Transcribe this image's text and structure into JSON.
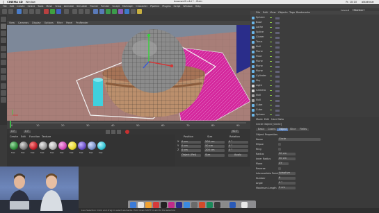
{
  "mac_menu": {
    "app_name": "CINEMA 4D",
    "items": [
      "Window"
    ],
    "clock": "Fr. 10:10",
    "user": "aldakhnar"
  },
  "c4d_menu": [
    "File",
    "Edit",
    "Create",
    "Select",
    "Tools",
    "Mesh",
    "Snap",
    "Animate",
    "Simulate",
    "Tracker",
    "Render",
    "Sculpt",
    "MoGraph",
    "Character",
    "Pipeline",
    "Plugins",
    "Script",
    "Window",
    "Help"
  ],
  "window_title": "bowowel2.c4d * - Main",
  "layout": {
    "label": "Layout",
    "value": "Startup"
  },
  "viewport_menu": [
    "View",
    "Cameras",
    "Display",
    "Options",
    "Filter",
    "Panel",
    "ProRender"
  ],
  "object_manager": {
    "menu": [
      "File",
      "Edit",
      "View",
      "Objects",
      "Tags",
      "Bookmarks"
    ],
    "rows": [
      {
        "name": "Sphere",
        "color": "#6bb6e8"
      },
      {
        "name": "Bowl",
        "color": "#6bb6e8"
      },
      {
        "name": "Lathe",
        "color": "#6bb6e8"
      },
      {
        "name": "Spline",
        "color": "#6bb6e8"
      },
      {
        "name": "Cloner",
        "color": "#6bb6e8"
      },
      {
        "name": "Torus",
        "color": "#6bb6e8"
      },
      {
        "name": "Null",
        "color": "#aaaaaa"
      },
      {
        "name": "Plane",
        "color": "#6bb6e8"
      },
      {
        "name": "Floor",
        "color": "#6bb6e8"
      },
      {
        "name": "Plane",
        "color": "#6bb6e8"
      },
      {
        "name": "Plane",
        "color": "#6bb6e8"
      },
      {
        "name": "Plane",
        "color": "#6bb6e8"
      },
      {
        "name": "Cylinder",
        "color": "#6bb6e8"
      },
      {
        "name": "Sky",
        "color": "#6bb6e8"
      },
      {
        "name": "Light",
        "color": "#d8d8d8"
      },
      {
        "name": "Camera",
        "color": "#d8d8d8"
      },
      {
        "name": "Null",
        "color": "#aaaaaa"
      },
      {
        "name": "Null",
        "color": "#aaaaaa"
      },
      {
        "name": "Cube",
        "color": "#6bb6e8"
      },
      {
        "name": "Cube",
        "color": "#6bb6e8"
      },
      {
        "name": "Sphere",
        "color": "#6bb6e8"
      }
    ]
  },
  "attribute_manager": {
    "menu": [
      "Mode",
      "Edit",
      "User Data"
    ],
    "title": "Circle Object [Circle]",
    "tabs": [
      "Basic",
      "Coord.",
      "Object",
      "Slice",
      "Fields"
    ],
    "section": "Object Properties",
    "props": [
      {
        "label": "Name",
        "value": "Circle"
      },
      {
        "label": "Ellipse",
        "value": ""
      },
      {
        "label": "Ring",
        "value": ""
      },
      {
        "label": "Radius",
        "value": "50 cm"
      },
      {
        "label": "Inner Radius",
        "value": "50 cm"
      },
      {
        "label": "Plane",
        "value": "XY"
      },
      {
        "label": "Reverse",
        "value": ""
      },
      {
        "label": "Intermediate Points",
        "value": "Adaptive"
      },
      {
        "label": "Number",
        "value": "8"
      },
      {
        "label": "Angle",
        "value": "5 °"
      },
      {
        "label": "Maximum Length",
        "value": "5 cm"
      }
    ]
  },
  "timeline": {
    "ticks": [
      "0",
      "5",
      "10",
      "15",
      "20",
      "25",
      "30",
      "35",
      "40",
      "45",
      "50",
      "55",
      "60",
      "65",
      "70",
      "75",
      "80",
      "85",
      "90"
    ],
    "start": "0 F",
    "end": "90 F",
    "current": "0 F"
  },
  "material_manager": {
    "menu": [
      "Create",
      "Edit",
      "Function",
      "Texture"
    ],
    "materials": [
      {
        "name": "Mat",
        "color": "#2f8a3a"
      },
      {
        "name": "Mat",
        "color": "#7a7a7a"
      },
      {
        "name": "Mat",
        "color": "#c0202a"
      },
      {
        "name": "Mat",
        "color": "#9a9a9a"
      },
      {
        "name": "Mat",
        "color": "#b0b0b0"
      },
      {
        "name": "Mat",
        "color": "#d14bb8"
      },
      {
        "name": "Mat",
        "color": "#e8d830"
      },
      {
        "name": "Mat",
        "color": "#6b4fc8"
      },
      {
        "name": "Mat",
        "color": "#7c92c8"
      },
      {
        "name": "Mat",
        "color": "#37c6d6"
      }
    ]
  },
  "coordinates": {
    "headers": [
      "Position",
      "Size",
      "Rotation"
    ],
    "rows": [
      {
        "axis": "X",
        "pos": "0 cm",
        "size": "200 cm",
        "rot": "0 °"
      },
      {
        "axis": "Y",
        "pos": "0 cm",
        "size": "50 cm",
        "rot": "0 °"
      },
      {
        "axis": "Z",
        "pos": "0 cm",
        "size": "200 cm",
        "rot": "0 °"
      }
    ],
    "mode": "Object (Rel)",
    "size_mode": "Size",
    "apply": "Apply"
  },
  "status": {
    "text": "Live Selection: Click and drag to select elements. Hold down SHIFT to add to the selection"
  },
  "dock_colors": [
    "#3b7bd8",
    "#e4e4e4",
    "#f0a030",
    "#d63a3a",
    "#222222",
    "#c02a8a",
    "#2a2a8a",
    "#3a8ae0",
    "#6a6a6a",
    "#d24a2a",
    "#1a8a5a",
    "#3a3a3a",
    "#8a8a8a",
    "#2a5ab8",
    "#e8e8e8"
  ]
}
